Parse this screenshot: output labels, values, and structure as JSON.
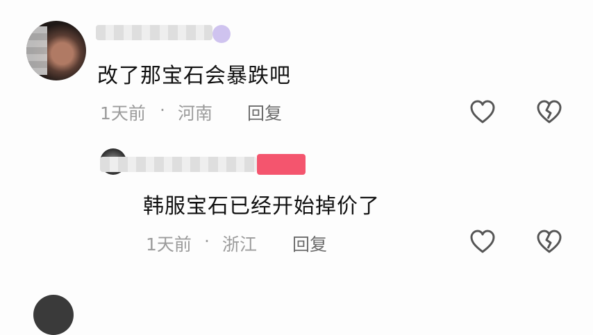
{
  "comments": [
    {
      "content": "改了那宝石会暴跌吧",
      "time": "1天前",
      "separator": "·",
      "location": "河南",
      "reply_label": "回复",
      "icons": [
        "heart-icon",
        "broken-heart-icon"
      ]
    },
    {
      "content": "韩服宝石已经开始掉价了",
      "time": "1天前",
      "separator": "·",
      "location": "浙江",
      "reply_label": "回复",
      "icons": [
        "heart-icon",
        "broken-heart-icon"
      ]
    }
  ],
  "colors": {
    "text": "#111111",
    "meta": "#9b9b9b",
    "icon_stroke": "#555555",
    "badge": "#f4556e"
  }
}
